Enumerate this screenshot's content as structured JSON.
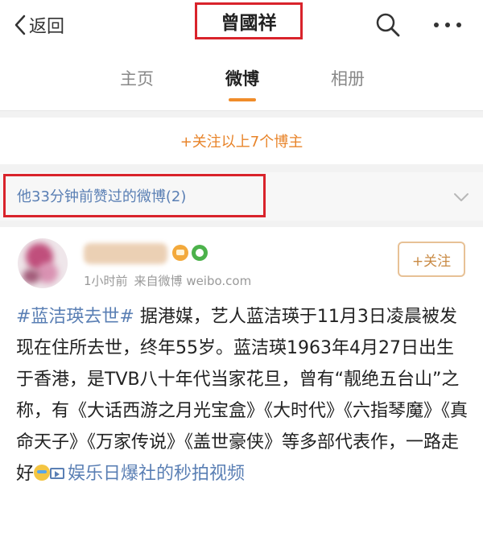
{
  "header": {
    "back_label": "返回",
    "title": "曾國祥",
    "search_icon": "search-icon",
    "more_icon": "more-icon"
  },
  "tabs": [
    {
      "label": "主页",
      "active": false
    },
    {
      "label": "微博",
      "active": true
    },
    {
      "label": "相册",
      "active": false
    }
  ],
  "follow_all_label": "+关注以上7个博主",
  "liked_section": {
    "label": "他33分钟前赞过的微博(2)"
  },
  "post": {
    "meta_time": "1小时前",
    "meta_source": "来自微博 weibo.com",
    "follow_label": "+关注",
    "topic": "#蓝洁瑛去世#",
    "body_text": " 据港媒，艺人蓝洁瑛于11月3日凌晨被发现在住所去世，终年55岁。蓝洁瑛1963年4月27日出生于香港，是TVB八十年代当家花旦，曾有“靓绝五台山”之称，有《大话西游之月光宝盒》《大时代》《六指琴魔》《真命天子》《万家传说》《盖世豪侠》等多部代表作，一路走好",
    "video_link": "娱乐日爆社的秒拍视频"
  },
  "colors": {
    "accent_orange": "#e8842a",
    "link_blue": "#5a7fb4",
    "highlight_red": "#d9232b"
  }
}
